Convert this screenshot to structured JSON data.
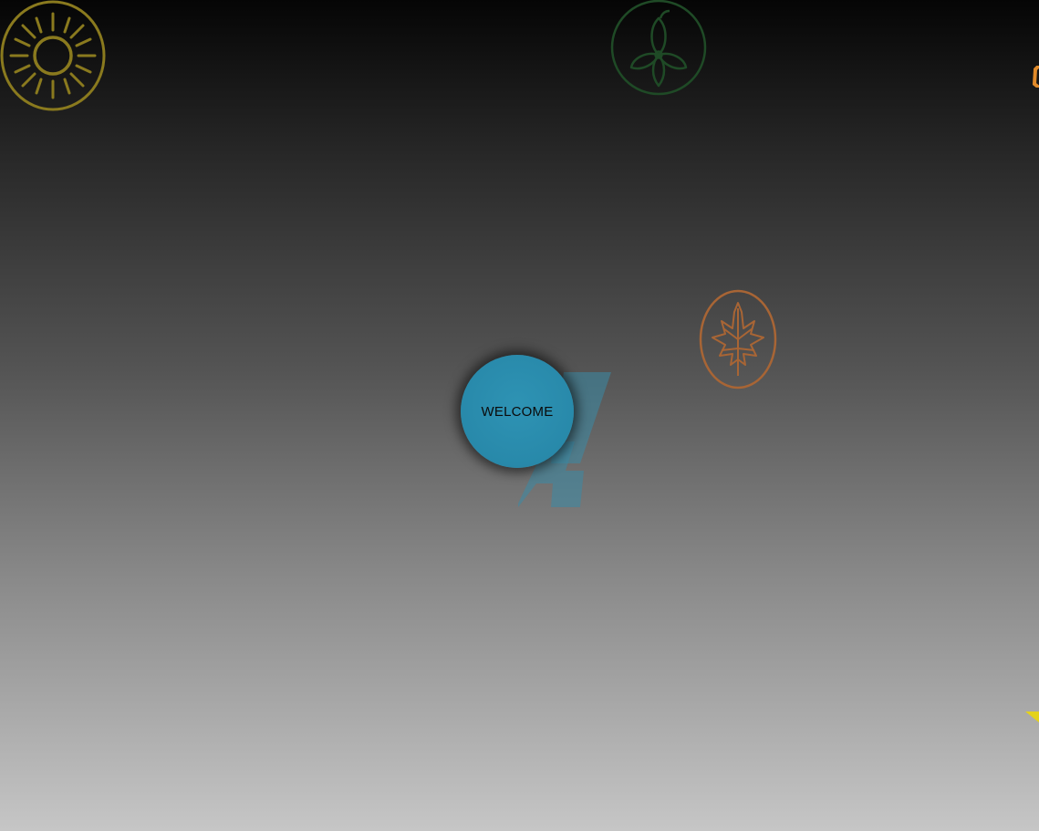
{
  "welcome": {
    "label": "WELCOME"
  },
  "badges": [
    {
      "name": "sun-badge",
      "icon": "sun-icon",
      "color": "#8a7a1e"
    },
    {
      "name": "flower-badge",
      "icon": "flower-icon",
      "color": "#1f4a26"
    },
    {
      "name": "leaf-badge",
      "icon": "maple-leaf-icon",
      "color": "#a86535"
    }
  ],
  "colors": {
    "button": "#2889aa",
    "logo": "#3a8aa6",
    "sun": "#8a7a1e",
    "flower": "#1f4a26",
    "leaf": "#a86535",
    "accent_orange": "#e08a2a",
    "accent_yellow": "#e4d21a"
  }
}
